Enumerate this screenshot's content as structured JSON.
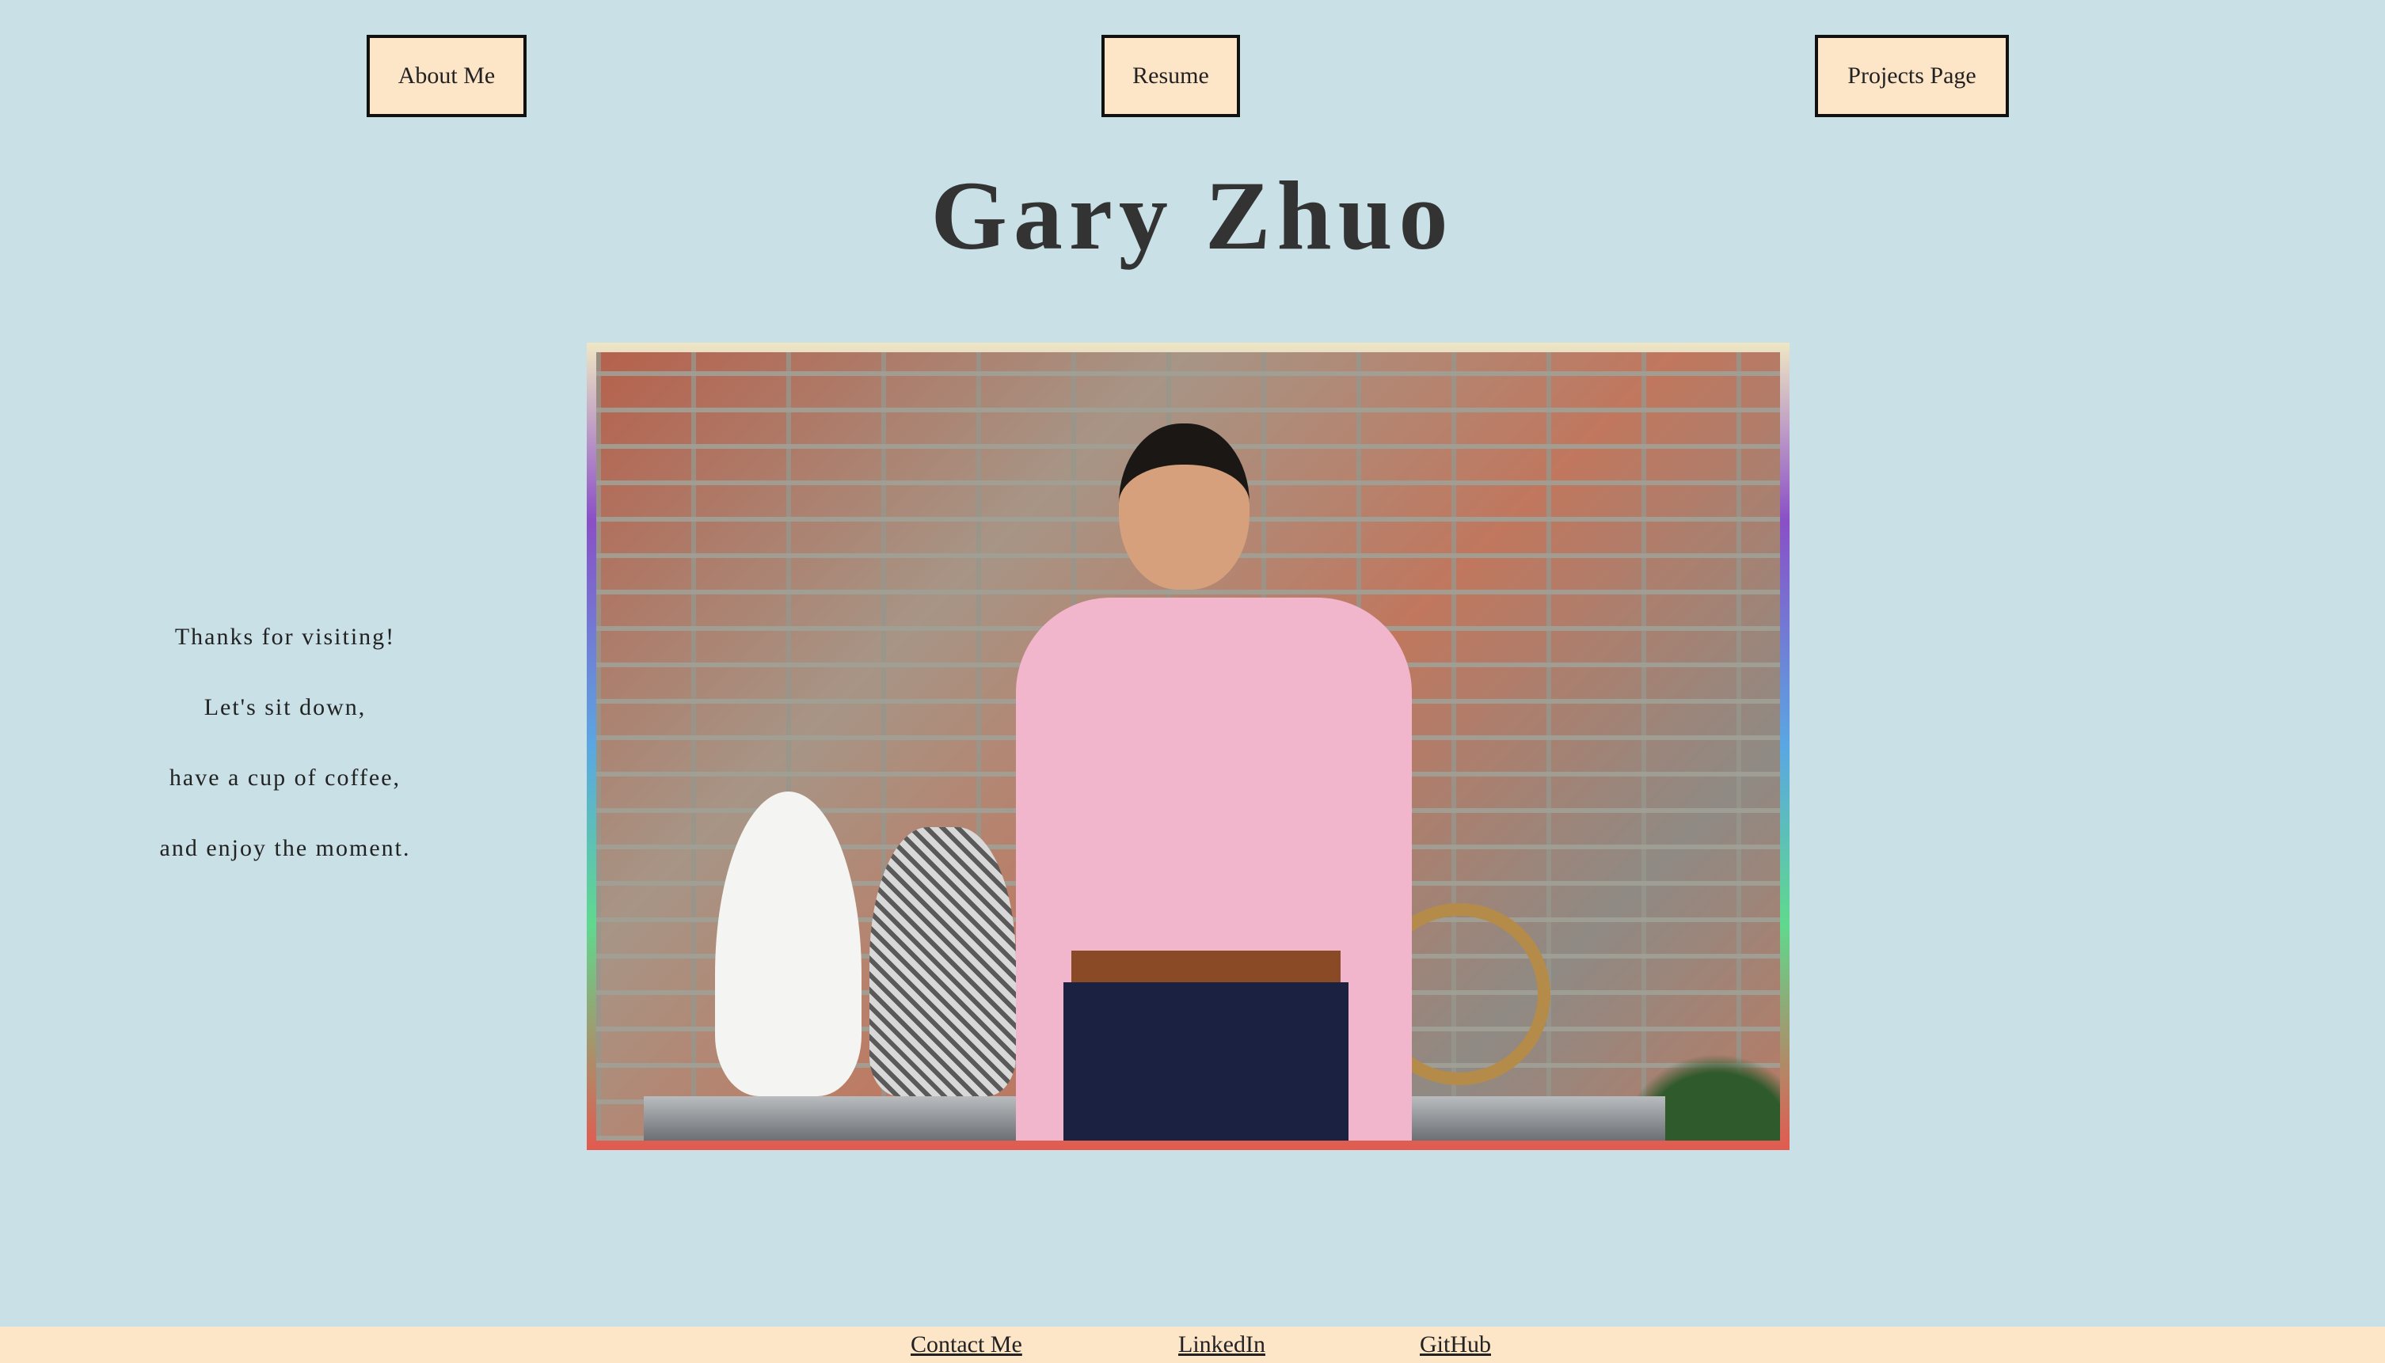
{
  "nav": {
    "about_label": "About Me",
    "resume_label": "Resume",
    "projects_label": "Projects Page"
  },
  "header": {
    "title": "Gary Zhuo"
  },
  "tagline": {
    "lines": [
      "Thanks for visiting!",
      "Let's sit down,",
      "have a cup of coffee,",
      "and enjoy the moment."
    ]
  },
  "footer": {
    "contact_label": "Contact Me",
    "linkedin_label": "LinkedIn",
    "github_label": "GitHub"
  },
  "colors": {
    "background": "#c8e0e6",
    "button_fill": "#fde5c8",
    "footer_fill": "#fde5c8",
    "title": "#333333"
  }
}
